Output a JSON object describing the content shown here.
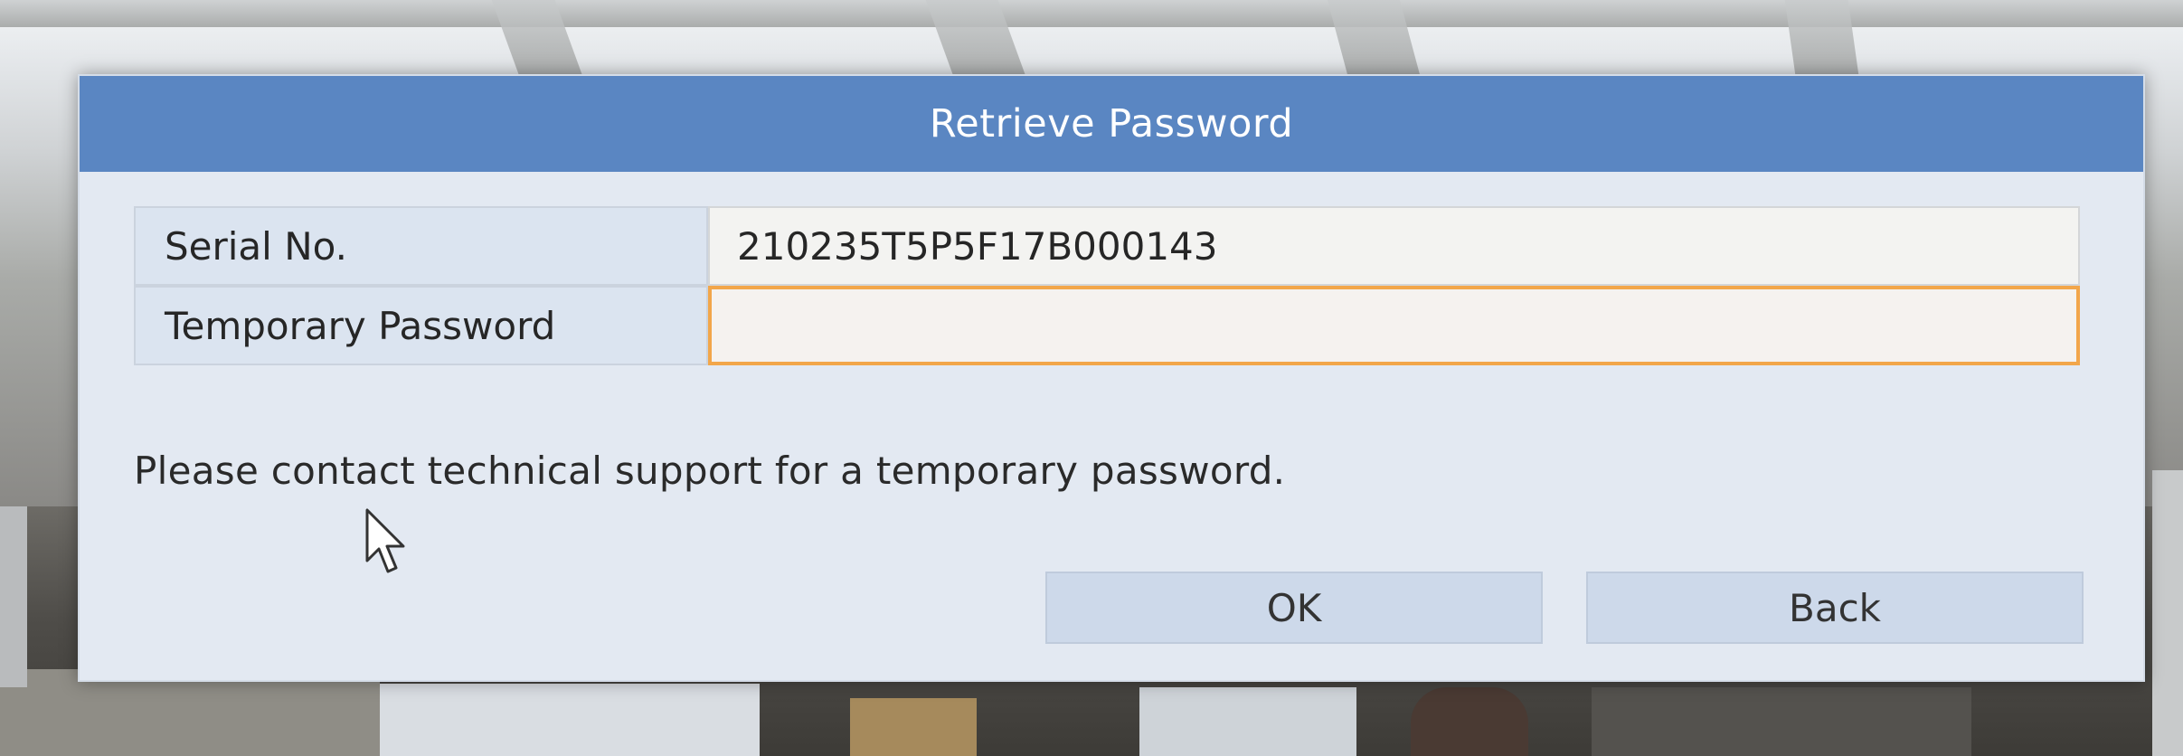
{
  "dialog": {
    "title": "Retrieve Password",
    "fields": {
      "serial_label": "Serial No.",
      "serial_value": "210235T5P5F17B000143",
      "temp_password_label": "Temporary Password",
      "temp_password_value": ""
    },
    "hint": "Please contact technical support for a temporary password.",
    "buttons": {
      "ok": "OK",
      "back": "Back"
    }
  },
  "colors": {
    "header": "#5a86c2",
    "dialog_bg": "#e3e9f2",
    "input_focus_border": "#f2a64a",
    "button_bg": "#cdd9ea"
  },
  "icons": {
    "cursor": "mouse-pointer-icon"
  }
}
